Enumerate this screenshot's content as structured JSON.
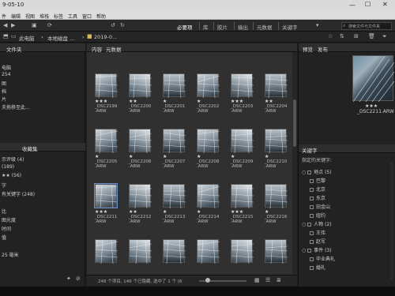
{
  "titlebar": {
    "title": "9-05-10"
  },
  "menu": [
    "件",
    "编辑",
    "视图",
    "堆栈",
    "标签",
    "工具",
    "窗口",
    "帮助"
  ],
  "workspace_tabs": [
    "必要项",
    "库",
    "胶片",
    "输出",
    "元数据",
    "关键字"
  ],
  "search_placeholder": "搜索文件与文件夹",
  "breadcrumb": [
    "此电脑",
    "本地磁盘 ...",
    "2019-0..."
  ],
  "left_panel": {
    "folders_tab": "文件夹",
    "folders": [
      "电脑",
      "254",
      "图",
      "档",
      "片",
      "夫拖移至此..."
    ],
    "filter_tab": "收藏集",
    "filters": [
      "示评级 (4)",
      "(189)",
      "★★ (56)",
      "字",
      "有关键字 (248)",
      "",
      "比",
      "图光度",
      "时间",
      "值",
      "",
      "25 毫米"
    ]
  },
  "content_tabs": [
    "内容",
    "元数据"
  ],
  "thumbnails": [
    {
      "stars": "★★★",
      "name": "_DSC2199\n.ARW"
    },
    {
      "stars": "★★",
      "name": "_DSC2200\n.ARW"
    },
    {
      "stars": "★",
      "name": "_DSC2201\n.ARW"
    },
    {
      "stars": "★",
      "name": "_DSC2202\n.ARW"
    },
    {
      "stars": "★★★",
      "name": "_DSC2203\n.ARW"
    },
    {
      "stars": "★★",
      "name": "_DSC2204\n.ARW"
    },
    {
      "stars": "★",
      "name": "_DSC2205\n.ARW"
    },
    {
      "stars": "★",
      "name": "_DSC2206\n.ARW"
    },
    {
      "stars": "★",
      "name": "_DSC2207\n.ARW"
    },
    {
      "stars": "★",
      "name": "_DSC2208\n.ARW"
    },
    {
      "stars": "★",
      "name": "_DSC2209\n.ARW"
    },
    {
      "stars": "★",
      "name": "_DSC2210\n.ARW"
    },
    {
      "stars": "★★★",
      "name": "_DSC2211\n.ARW"
    },
    {
      "stars": "★★",
      "name": "_DSC2212\n.ARW"
    },
    {
      "stars": "★",
      "name": "_DSC2213\n.ARW"
    },
    {
      "stars": "★",
      "name": "_DSC2214\n.ARW"
    },
    {
      "stars": "★★★",
      "name": "_DSC2215\n.ARW"
    },
    {
      "stars": "★",
      "name": "_DSC2216\n.ARW"
    },
    {
      "stars": "",
      "name": ""
    },
    {
      "stars": "",
      "name": ""
    },
    {
      "stars": "",
      "name": ""
    },
    {
      "stars": "",
      "name": ""
    },
    {
      "stars": "",
      "name": ""
    },
    {
      "stars": "",
      "name": ""
    }
  ],
  "selected_index": 12,
  "status": "248 个项目, 146 个已隐藏, 选中了 1 个 (6",
  "right_panel": {
    "tabs": [
      "预览",
      "发布"
    ],
    "preview_stars": "★★★",
    "preview_name": "_DSC2211.ARW",
    "keywords_title": "关键字",
    "keywords_sub": "指定的关键字:",
    "keywords": [
      {
        "label": "地点 (5)",
        "level": 0,
        "group": true
      },
      {
        "label": "巴黎",
        "level": 1
      },
      {
        "label": "北京",
        "level": 1
      },
      {
        "label": "东京",
        "level": 1
      },
      {
        "label": "旧金山",
        "level": 1
      },
      {
        "label": "纽约",
        "level": 1
      },
      {
        "label": "人物 (2)",
        "level": 0,
        "group": true
      },
      {
        "label": "王伟",
        "level": 1
      },
      {
        "label": "赵军",
        "level": 1
      },
      {
        "label": "事件 (3)",
        "level": 0,
        "group": true
      },
      {
        "label": "毕业典礼",
        "level": 1
      },
      {
        "label": "婚礼",
        "level": 1
      }
    ]
  },
  "colors": {
    "accent": "#6a8fd0",
    "panel": "#222222",
    "content": "#303030"
  }
}
